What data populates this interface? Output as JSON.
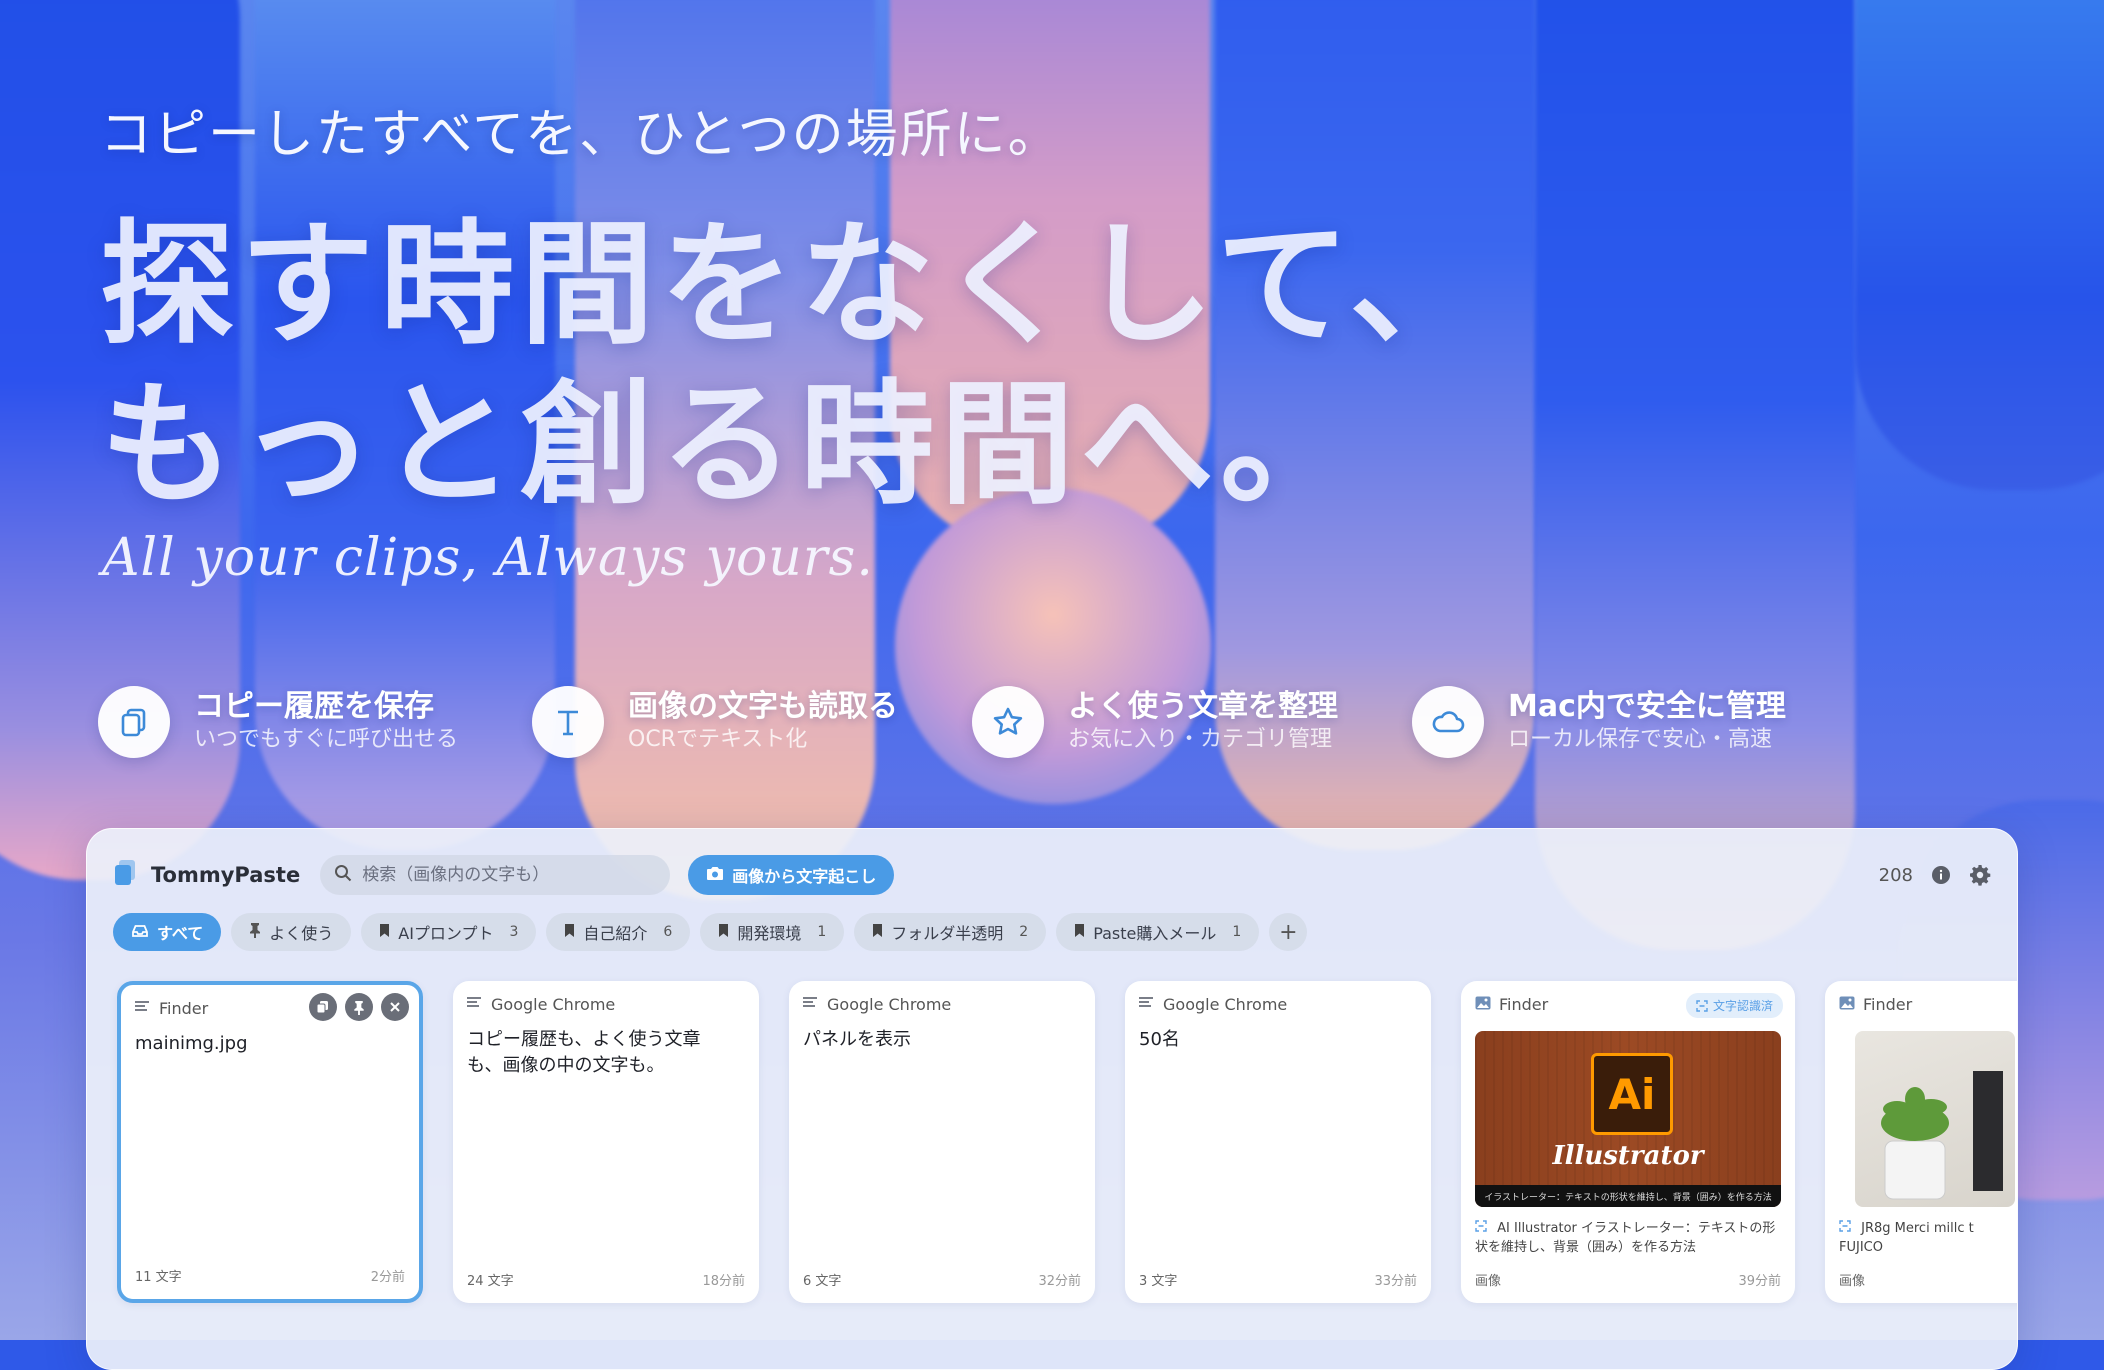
{
  "hero": {
    "eyebrow": "コピーしたすべてを、ひとつの場所に。",
    "headline_line1": "探す時間をなくして、",
    "headline_line2": "もっと創る時間へ。",
    "tagline": "All your clips, Always yours."
  },
  "features": [
    {
      "icon": "copy-icon",
      "title": "コピー履歴を保存",
      "subtitle": "いつでもすぐに呼び出せる"
    },
    {
      "icon": "text-t-icon",
      "title": "画像の文字も読取る",
      "subtitle": "OCRでテキスト化"
    },
    {
      "icon": "star-icon",
      "title": "よく使う文章を整理",
      "subtitle": "お気に入り・カテゴリ管理"
    },
    {
      "icon": "cloud-icon",
      "title": "Mac内で安全に管理",
      "subtitle": "ローカル保存で安心・高速"
    }
  ],
  "app": {
    "name": "TommyPaste",
    "search_placeholder": "検索（画像内の文字も）",
    "ocr_button": "画像から文字起こし",
    "total_count": "208"
  },
  "tabs": [
    {
      "label": "すべて",
      "count": "",
      "active": true,
      "icon": "tray-icon"
    },
    {
      "label": "よく使う",
      "count": "",
      "active": false,
      "icon": "pin-icon"
    },
    {
      "label": "AIプロンプト",
      "count": "3",
      "active": false,
      "icon": "bookmark-icon"
    },
    {
      "label": "自己紹介",
      "count": "6",
      "active": false,
      "icon": "bookmark-icon"
    },
    {
      "label": "開発環境",
      "count": "1",
      "active": false,
      "icon": "bookmark-icon"
    },
    {
      "label": "フォルダ半透明",
      "count": "2",
      "active": false,
      "icon": "bookmark-icon"
    },
    {
      "label": "Paste購入メール",
      "count": "1",
      "active": false,
      "icon": "bookmark-icon"
    }
  ],
  "add_tab": "+",
  "cards": [
    {
      "source": "Finder",
      "content": "mainimg.jpg",
      "chars": "11 文字",
      "time": "2分前"
    },
    {
      "source": "Google Chrome",
      "content": "コピー履歴も、よく使う文章も、画像の中の文字も。",
      "chars": "24 文字",
      "time": "18分前"
    },
    {
      "source": "Google Chrome",
      "content": "パネルを表示",
      "chars": "6 文字",
      "time": "32分前"
    },
    {
      "source": "Google Chrome",
      "content": "50名",
      "chars": "3 文字",
      "time": "33分前"
    },
    {
      "source": "Finder",
      "badge": "文字認識済",
      "thumb_logo": "Ai",
      "thumb_title": "Illustrator",
      "thumb_bar": "イラストレーター：テキストの形状を維持し、背景（囲み）を作る方法",
      "caption": "AI Illustrator イラストレーター：テキストの形状を維持し、背景（囲み）を作る方法",
      "kind": "画像",
      "time": "39分前"
    },
    {
      "source": "Finder",
      "caption": "JR8g Merci millc t FUJICO",
      "kind": "画像"
    }
  ]
}
